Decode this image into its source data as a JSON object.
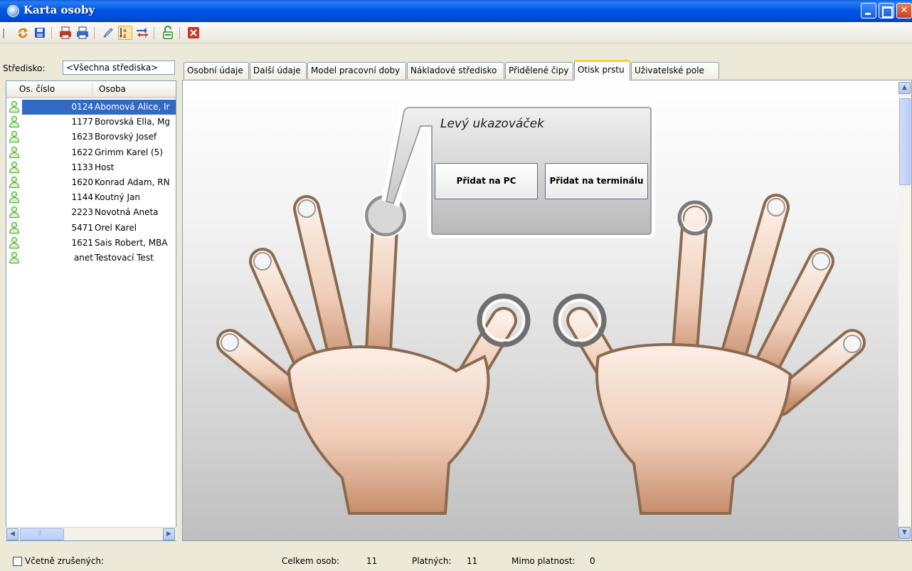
{
  "window": {
    "title": "Karta osoby"
  },
  "toolbar": {
    "buttons": [
      "refresh-icon",
      "save-icon",
      "print-icon",
      "print-preview-icon",
      "edit-icon",
      "sort-icon",
      "transfer-icon",
      "unlock-icon",
      "close-icon"
    ]
  },
  "filter": {
    "label": "Středisko:",
    "value": "<Všechna střediska>"
  },
  "list": {
    "columns": [
      "Os. číslo",
      "Osoba"
    ],
    "rows": [
      {
        "num": "0124",
        "name": "Abomová Alice, Ir",
        "selected": true
      },
      {
        "num": "1177",
        "name": "Borovská Ella, Mg"
      },
      {
        "num": "1623",
        "name": "Borovský Josef"
      },
      {
        "num": "1622",
        "name": "Grimm Karel (5)"
      },
      {
        "num": "1133",
        "name": "Host"
      },
      {
        "num": "1620",
        "name": "Konrad Adam, RN"
      },
      {
        "num": "1144",
        "name": "Koutný Jan"
      },
      {
        "num": "2223",
        "name": "Novotná Aneta"
      },
      {
        "num": "5471",
        "name": "Orel Karel"
      },
      {
        "num": "1621",
        "name": "Sais Robert, MBA"
      },
      {
        "num": "anet",
        "name": "Testovací Test"
      }
    ]
  },
  "tabs": [
    "Osobní údaje",
    "Další údaje",
    "Model pracovní doby",
    "Nákladové středisko",
    "Přidělené čipy",
    "Otisk prstu",
    "Uživatelské pole"
  ],
  "active_tab": "Otisk prstu",
  "fingerprint": {
    "selected_finger": "Levý ukazováček",
    "btn_pc": "Přidat na PC",
    "btn_terminal": "Přidat na terminálu"
  },
  "status": {
    "include_cancelled": "Včetně zrušených:",
    "total_label": "Celkem osob:",
    "total_value": "11",
    "valid_label": "Platných:",
    "valid_value": "11",
    "invalid_label": "Mimo platnost:",
    "invalid_value": "0"
  },
  "colors": {
    "titlebar": "#0058e6",
    "selection": "#316ac5",
    "tab_accent": "#ffc83c",
    "person_icon": "#3da020"
  }
}
